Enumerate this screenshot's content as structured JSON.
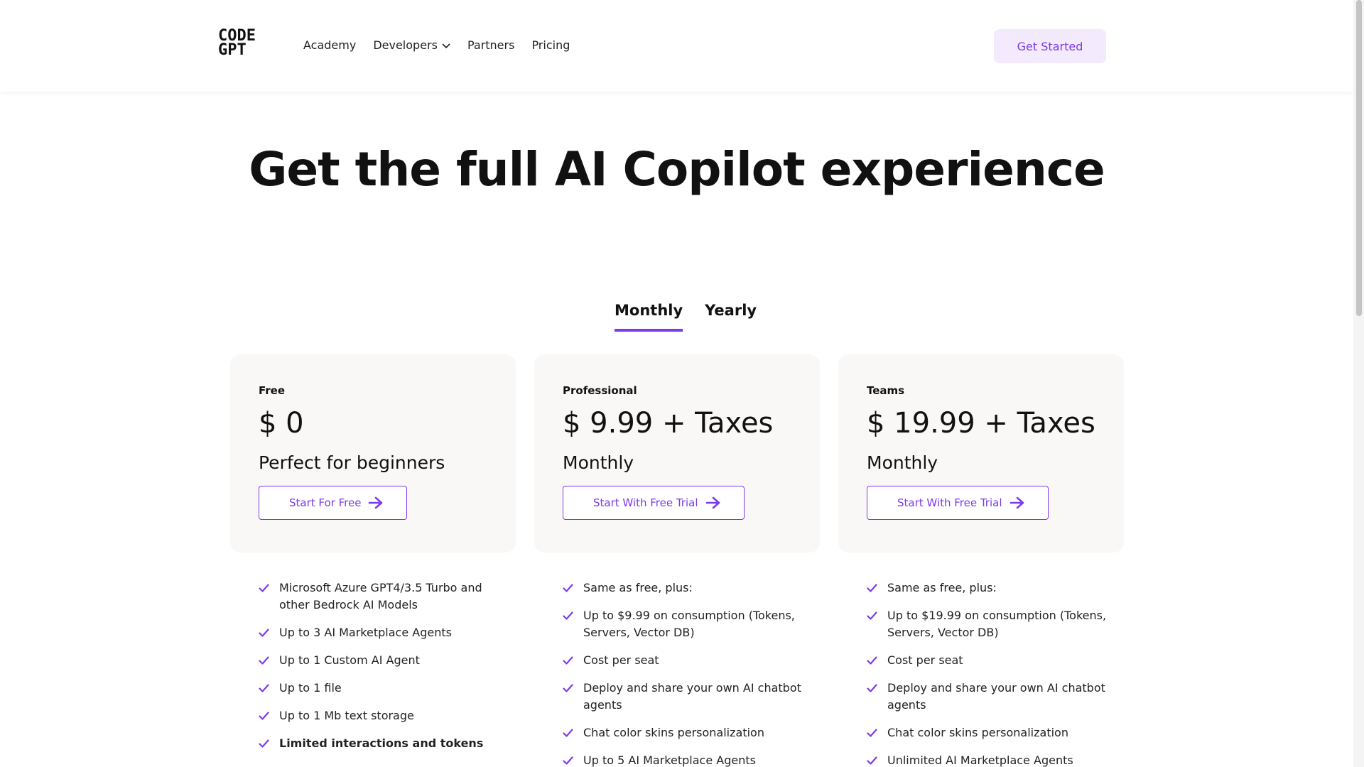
{
  "header": {
    "logo": {
      "line1": "CODE",
      "line2": "GPT"
    },
    "nav": [
      {
        "label": "Academy"
      },
      {
        "label": "Developers",
        "has_dropdown": true,
        "icon": "chevron-down-icon"
      },
      {
        "label": "Partners"
      },
      {
        "label": "Pricing"
      }
    ],
    "cta_label": "Get Started"
  },
  "hero": {
    "title": "Get the full AI Copilot experience"
  },
  "billing_toggle": {
    "options": [
      "Monthly",
      "Yearly"
    ],
    "selected": "Monthly"
  },
  "colors": {
    "accent": "#7c3aed",
    "accent_light": "#f3eafd",
    "card_bg": "#f9f8f6"
  },
  "plans": [
    {
      "name": "Free",
      "price": "$ 0",
      "subtitle": "Perfect for beginners",
      "button": "Start For Free",
      "features": [
        "Microsoft Azure GPT4/3.5 Turbo and other Bedrock AI Models",
        "Up to 3 AI Marketplace Agents",
        "Up to 1 Custom AI Agent",
        "Up to 1 file",
        "Up to 1 Mb text storage",
        "Limited interactions and tokens"
      ]
    },
    {
      "name": "Professional",
      "price": "$ 9.99 + Taxes",
      "subtitle": "Monthly",
      "button": "Start With Free Trial",
      "features": [
        "Same as free, plus:",
        "Up to $9.99 on consumption (Tokens, Servers, Vector DB)",
        "Cost per seat",
        "Deploy and share your own AI chatbot agents",
        "Chat color skins personalization",
        "Up to 5 AI Marketplace Agents"
      ]
    },
    {
      "name": "Teams",
      "price": "$ 19.99 + Taxes",
      "subtitle": "Monthly",
      "button": "Start With Free Trial",
      "features": [
        "Same as free, plus:",
        "Up to $19.99 on consumption (Tokens, Servers, Vector DB)",
        "Cost per seat",
        "Deploy and share your own AI chatbot agents",
        "Chat color skins personalization",
        "Unlimited AI Marketplace Agents"
      ]
    }
  ]
}
